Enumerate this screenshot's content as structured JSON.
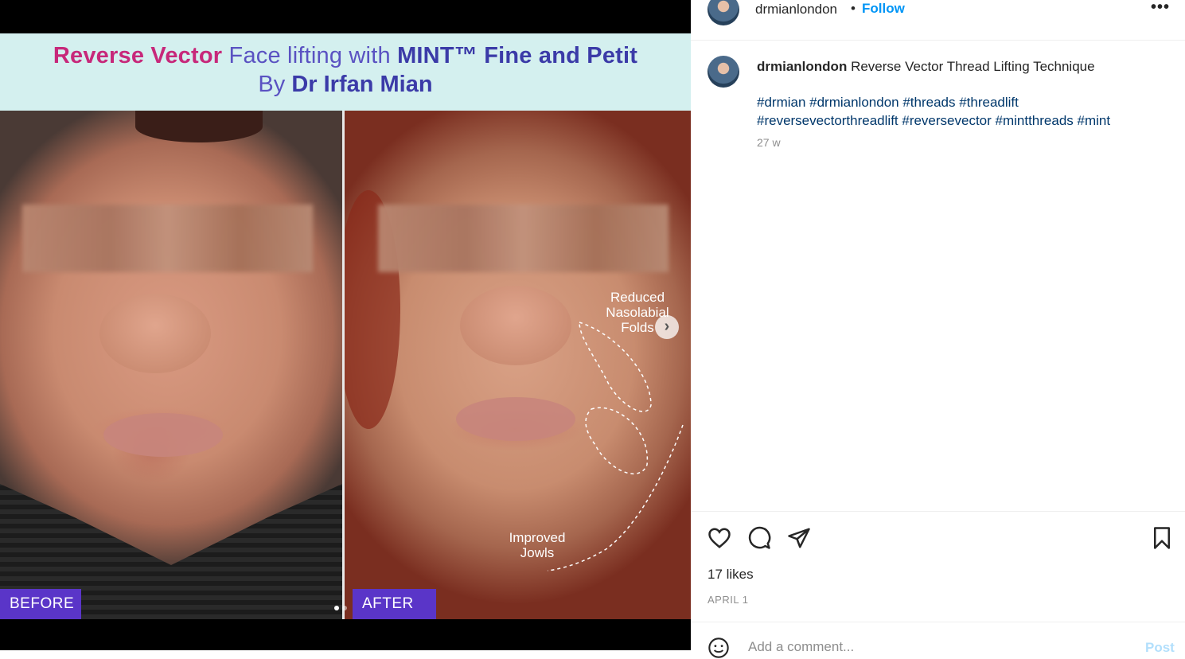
{
  "media": {
    "banner": {
      "line1_part1": "Reverse Vector",
      "line1_part2": "Face lifting with",
      "line1_part3": "MINT™ Fine and Petit",
      "line2_part1": "By",
      "line2_part2": "Dr Irfan Mian"
    },
    "before_label": "BEFORE",
    "after_label": "AFTER",
    "annotation_nasolabial": "Reduced Nasolabial Folds",
    "annotation_jowls": "Improved Jowls",
    "carousel": {
      "count": 2,
      "active_index": 1
    }
  },
  "post": {
    "username": "drmianlondon",
    "separator": "•",
    "follow_label": "Follow",
    "more_label": "•••",
    "caption_username": "drmianlondon",
    "caption_text": "Reverse Vector Thread Lifting Technique",
    "hashtags_line1": "#drmian #drmianlondon #threads #threadlift",
    "hashtags_line2": "#reversevectorthreadlift #reversevector #mintthreads #mint",
    "age": "27 w",
    "likes": "17 likes",
    "date": "APRIL 1",
    "comment_placeholder": "Add a comment...",
    "post_label": "Post"
  },
  "icons": [
    "heart-icon",
    "comment-icon",
    "share-icon",
    "bookmark-icon",
    "emoji-icon",
    "chevron-right-icon"
  ],
  "colors": {
    "follow": "#0095f6",
    "hashtag": "#00376b",
    "tag_bg": "#5a35c8",
    "banner_bg": "#d4f0ef",
    "banner_accent": "#c7287a"
  }
}
